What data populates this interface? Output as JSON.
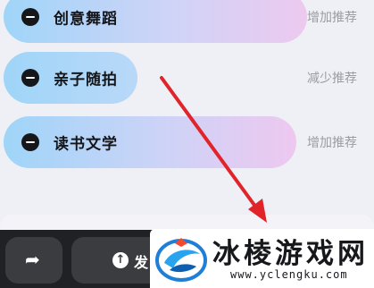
{
  "rows": [
    {
      "label": "创意舞蹈",
      "action": "增加推荐"
    },
    {
      "label": "亲子随拍",
      "action": "减少推荐"
    },
    {
      "label": "读书文学",
      "action": "增加推荐"
    }
  ],
  "bottom_bar": {
    "post_label": "发"
  },
  "watermark": {
    "title": "冰棱游戏网",
    "url": "www.yclengku.com"
  },
  "colors": {
    "pill_start": "#9fd5f8",
    "pill_end": "#eec8ef",
    "arrow": "#e0242a",
    "bar": "#202124"
  },
  "icons": [
    "minus-circle-icon",
    "share-icon",
    "upload-icon",
    "snowflake-logo-icon",
    "red-arrow"
  ]
}
